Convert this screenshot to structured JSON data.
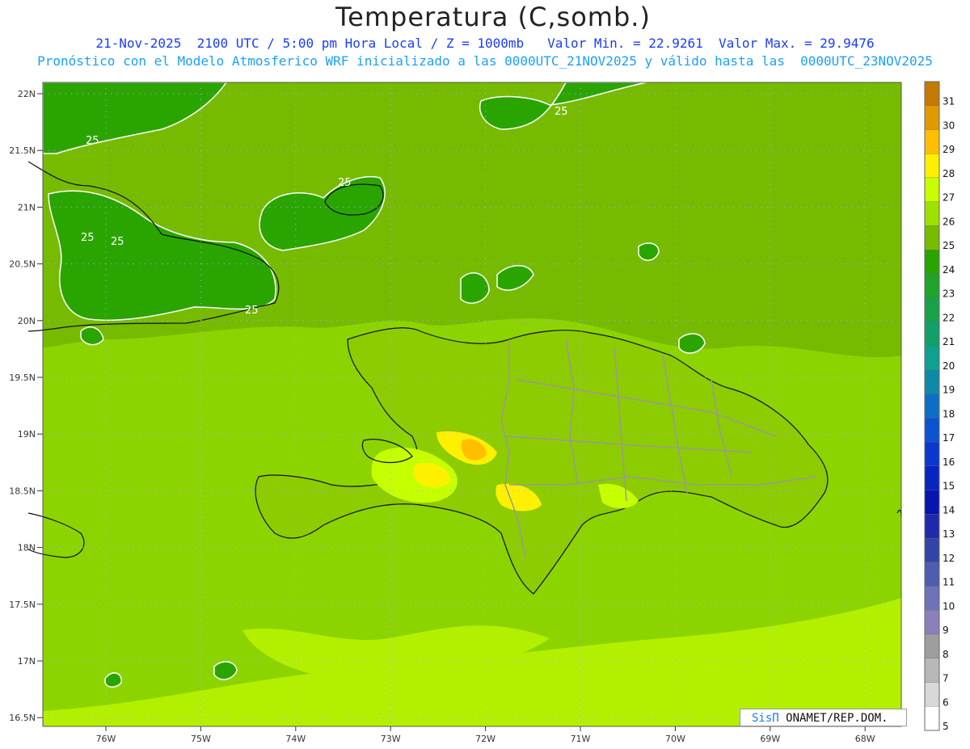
{
  "header": {
    "title": "Temperatura (C,somb.)",
    "line1": "21-Nov-2025  2100 UTC / 5:00 pm Hora Local / Z = 1000mb   Valor Min. = 22.9261  Valor Max. = 29.9476",
    "line2": "Pronóstico con el Modelo Atmosferico WRF inicializado a las 0000UTC_21NOV2025 y válido hasta las  0000UTC_23NOV2025"
  },
  "axes": {
    "lat_labels": [
      "22N",
      "21.5N",
      "21N",
      "20.5N",
      "20N",
      "19.5N",
      "19N",
      "18.5N",
      "18N",
      "17.5N",
      "17N",
      "16.5N"
    ],
    "lon_labels": [
      "76W",
      "75W",
      "74W",
      "73W",
      "72W",
      "71W",
      "70W",
      "69W",
      "68W"
    ]
  },
  "contour_labels": [
    "25",
    "25",
    "25",
    "25",
    "25",
    "25"
  ],
  "colorbar": {
    "ticks": [
      "31",
      "30",
      "29",
      "28",
      "27",
      "26",
      "25",
      "24",
      "23",
      "22",
      "21",
      "20",
      "19",
      "18",
      "17",
      "16",
      "15",
      "14",
      "13",
      "12",
      "11",
      "10",
      "9",
      "8",
      "7",
      "6",
      "5"
    ],
    "colors": [
      "#c47a00",
      "#e09a00",
      "#ffbf00",
      "#fff000",
      "#c8ff00",
      "#9ee000",
      "#76bb00",
      "#2aa500",
      "#1fa32a",
      "#17a24a",
      "#12a06a",
      "#0fa090",
      "#0e8aa8",
      "#0e6ec4",
      "#0d52d0",
      "#0b38cc",
      "#0a24c0",
      "#0814b0",
      "#1f2aaa",
      "#3344a8",
      "#4f5cb0",
      "#6e72b8",
      "#8c80b8",
      "#9e9e9e",
      "#b8b8b8",
      "#d8d8d8",
      "#ffffff"
    ]
  },
  "credit": {
    "brand": "SisΠ",
    "text": " ONAMET/REP.DOM."
  },
  "map_colors": {
    "sea_base": "#8cd400",
    "north_band": "#76bb00",
    "land": "#8ccc00",
    "warm": "#c6ff00",
    "hot": "#fff000",
    "hotter": "#ffbf00",
    "cool": "#2aa500"
  }
}
